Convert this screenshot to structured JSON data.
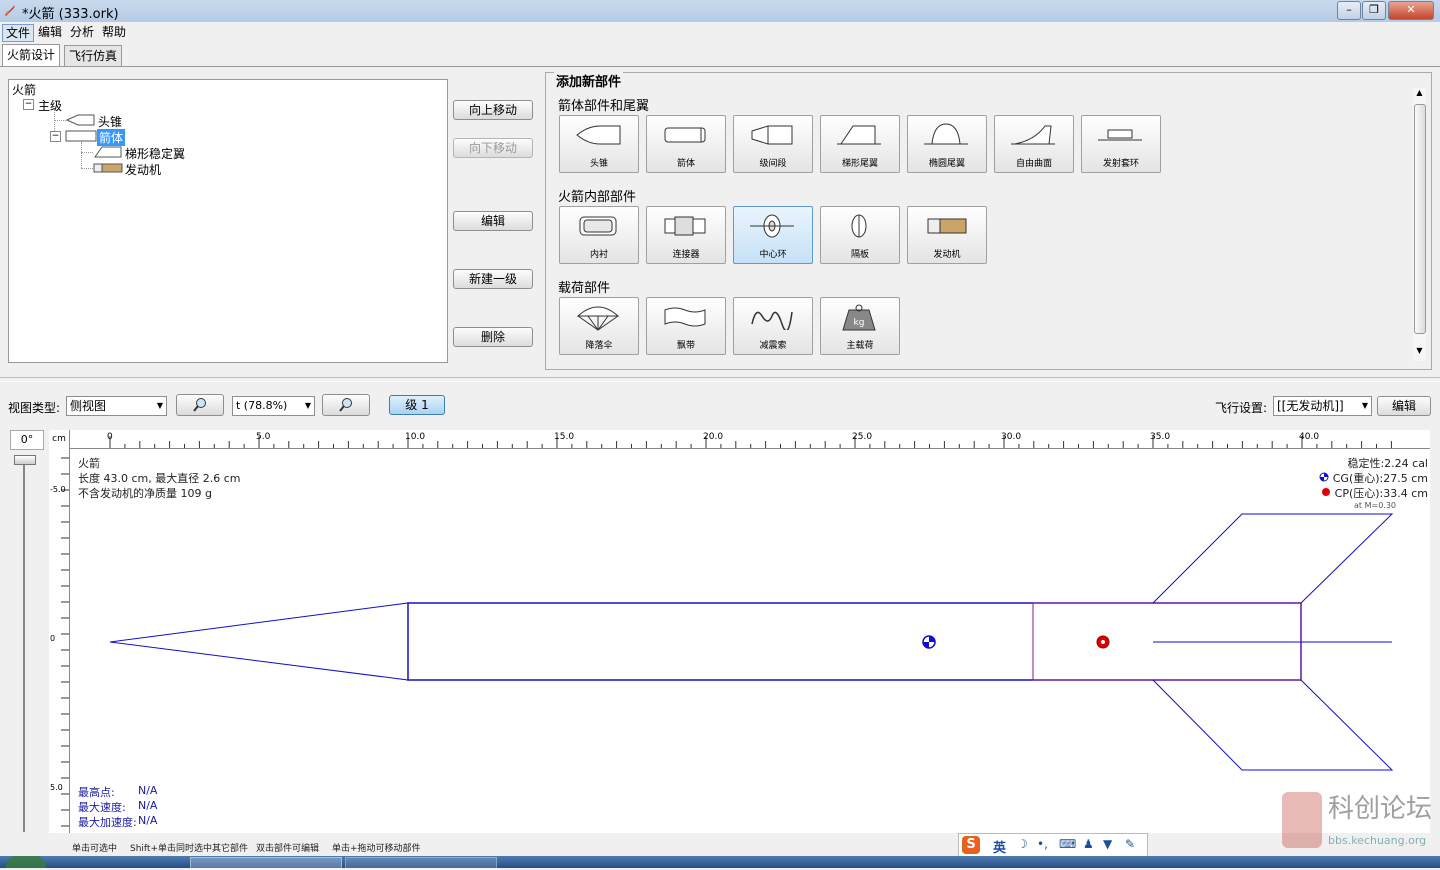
{
  "window": {
    "title": "*火箭 (333.ork)"
  },
  "menu": {
    "file": "文件",
    "edit": "编辑",
    "analyze": "分析",
    "help": "帮助"
  },
  "tabs": {
    "design": "火箭设计",
    "flight": "飞行仿真"
  },
  "tree": {
    "root": "火箭",
    "stage": "主级",
    "nose": "头锥",
    "body": "箭体",
    "fins": "梯形稳定翼",
    "motor": "发动机"
  },
  "actions": {
    "move_up": "向上移动",
    "move_down": "向下移动",
    "edit": "编辑",
    "new_stage": "新建一级",
    "delete": "删除"
  },
  "add_panel": {
    "title": "添加新部件",
    "section_body": "箭体部件和尾翼",
    "section_inner": "火箭内部部件",
    "section_payload": "载荷部件",
    "body_parts": [
      "头锥",
      "箭体",
      "级间段",
      "梯形尾翼",
      "椭圆尾翼",
      "自由曲面",
      "发射套环"
    ],
    "inner_parts": [
      "内衬",
      "连接器",
      "中心环",
      "隔板",
      "发动机"
    ],
    "payload_parts": [
      "降落伞",
      "飘带",
      "减震索",
      "主载荷"
    ],
    "payload_kg": "kg"
  },
  "view": {
    "type_label": "视图类型:",
    "type_value": "侧视图",
    "zoom_value": "t  (78.8%)",
    "stage_button": "级 1",
    "flight_label": "飞行设置:",
    "flight_value": "[[无发动机]]",
    "flight_edit": "编辑",
    "angle": "0°",
    "unit": "cm"
  },
  "rocket_info": {
    "name": "火箭",
    "dims": "长度 43.0 cm, 最大直径 2.6 cm",
    "mass": "不含发动机的净质量 109 g",
    "stability": "稳定性:2.24 cal",
    "cg": "CG(重心):27.5 cm",
    "cp": "CP(压心):33.4 cm",
    "mach": "at M=0.30",
    "apogee_label": "最高点:",
    "apogee": "N/A",
    "vmax_label": "最大速度:",
    "vmax": "N/A",
    "amax_label": "最大加速度:",
    "amax": "N/A"
  },
  "ruler": {
    "top": [
      "0",
      "5.0",
      "10.0",
      "15.0",
      "20.0",
      "25.0",
      "30.0",
      "35.0",
      "40.0"
    ],
    "left": [
      "-5.0",
      "0",
      "5.0"
    ]
  },
  "status": {
    "hint1": "单击可选中",
    "hint2": "Shift+单击同时选中其它部件",
    "hint3": "双击部件可编辑",
    "hint4": "单击+拖动可移动部件"
  },
  "ime": {
    "lang": "英"
  },
  "watermark": {
    "title": "科创论坛",
    "sub": "bbs.kechuang.org"
  },
  "colors": {
    "rocket": "#1010c8",
    "cg": "#1010c8",
    "cp": "#e00000",
    "selection": "#3399ff"
  }
}
